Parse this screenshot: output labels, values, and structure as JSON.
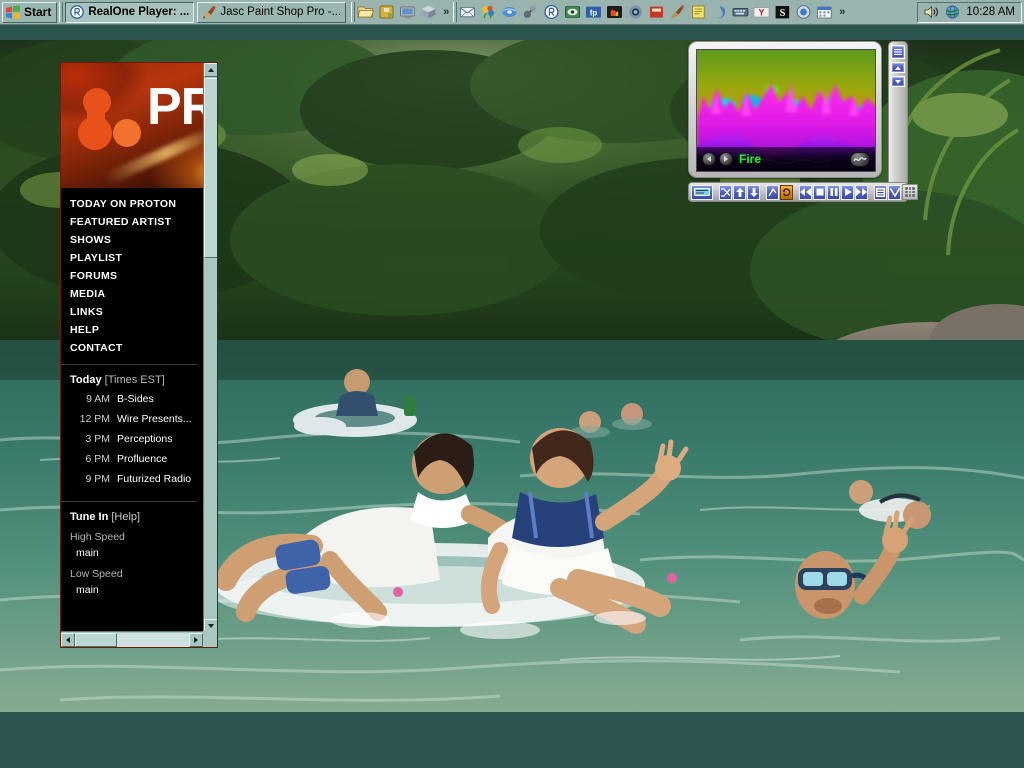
{
  "taskbar": {
    "start_label": "Start",
    "start_icon": "windows-flag-icon",
    "task_buttons": [
      {
        "label": "RealOne Player: ...",
        "icon": "realone-icon",
        "active": true
      },
      {
        "label": "Jasc Paint Shop Pro -...",
        "icon": "paintshop-icon",
        "active": false
      }
    ],
    "quick_launch": [
      {
        "icon": "folder-open-icon"
      },
      {
        "icon": "puzzle-icon"
      },
      {
        "icon": "network-icon"
      },
      {
        "icon": "box-icon"
      }
    ],
    "quick_launch_overflow": "»",
    "tray_icons": [
      {
        "icon": "mail-icon"
      },
      {
        "icon": "flower-icon"
      },
      {
        "icon": "bluedisc-icon"
      },
      {
        "icon": "balls-icon"
      },
      {
        "icon": "realone-tray-icon"
      },
      {
        "icon": "eye-monitor-icon"
      },
      {
        "icon": "ftp-icon"
      },
      {
        "icon": "fire-icon"
      },
      {
        "icon": "camera-icon"
      },
      {
        "icon": "red-box-icon"
      },
      {
        "icon": "brush-icon"
      },
      {
        "icon": "yellow-note-icon"
      },
      {
        "icon": "swirl-icon"
      },
      {
        "icon": "keyboard-icon"
      },
      {
        "icon": "yahoo-icon"
      },
      {
        "icon": "s-black-icon"
      },
      {
        "icon": "blue-circle-icon"
      },
      {
        "icon": "calendar-icon"
      }
    ],
    "tray_overflow": "»",
    "tray_status": [
      {
        "icon": "volume-speaker-icon"
      },
      {
        "icon": "globe-icon"
      }
    ],
    "clock": "10:28 AM"
  },
  "radio_panel": {
    "logo_text": "PR",
    "logo_mark": "proton-molecule-icon",
    "nav_items": [
      {
        "label": "TODAY ON PROTON"
      },
      {
        "label": "FEATURED ARTIST"
      },
      {
        "label": "SHOWS"
      },
      {
        "label": "PLAYLIST"
      },
      {
        "label": "FORUMS"
      },
      {
        "label": "MEDIA"
      },
      {
        "label": "LINKS"
      },
      {
        "label": "HELP"
      },
      {
        "label": "CONTACT"
      }
    ],
    "schedule": {
      "heading": "Today",
      "timezone": "[Times EST]",
      "rows": [
        {
          "time": "9 AM",
          "show": "B-Sides"
        },
        {
          "time": "12 PM",
          "show": "Wire Presents..."
        },
        {
          "time": "3 PM",
          "show": "Perceptions"
        },
        {
          "time": "6 PM",
          "show": "Profluence"
        },
        {
          "time": "9 PM",
          "show": "Futurized Radio"
        }
      ]
    },
    "tunein": {
      "heading": "Tune In",
      "help": "[Help]",
      "streams": [
        {
          "label": "High Speed",
          "link": "main"
        },
        {
          "label": "Low Speed",
          "link": "main"
        }
      ]
    },
    "colors": {
      "accent_orange": "#d4430c",
      "panel_bg": "#000000",
      "text": "#ffffff"
    }
  },
  "player": {
    "visualization_name": "Fire",
    "viz_name_color": "#35dd35",
    "viz_prev_icon": "prev-triangle-icon",
    "viz_next_icon": "next-triangle-icon",
    "viz_wave_icon": "waveform-icon",
    "side_strip": [
      {
        "icon": "menu-lines-icon"
      },
      {
        "icon": "scroll-up-icon"
      },
      {
        "icon": "scroll-down-icon"
      }
    ],
    "controls": [
      {
        "icon": "display-screen-icon",
        "active": false,
        "wide": true
      },
      {
        "icon": "shuffle-icon",
        "active": false
      },
      {
        "icon": "move-up-icon",
        "active": false
      },
      {
        "icon": "move-down-icon",
        "active": false
      },
      {
        "icon": "sort-icon",
        "active": false
      },
      {
        "icon": "repeat-icon",
        "active": true
      },
      {
        "icon": "rewind-icon",
        "active": false
      },
      {
        "icon": "stop-icon",
        "active": false
      },
      {
        "icon": "pause-icon",
        "active": false
      },
      {
        "icon": "play-icon",
        "active": false
      },
      {
        "icon": "fast-forward-icon",
        "active": false
      },
      {
        "icon": "playlist-icon",
        "active": false
      },
      {
        "icon": "chevron-down-icon",
        "active": false
      }
    ],
    "resize_grip_icon": "resize-grip-icon"
  },
  "desktop": {
    "wallpaper_description": "photo of people floating on inner tubes in a river",
    "background_color": "#2c5550"
  }
}
